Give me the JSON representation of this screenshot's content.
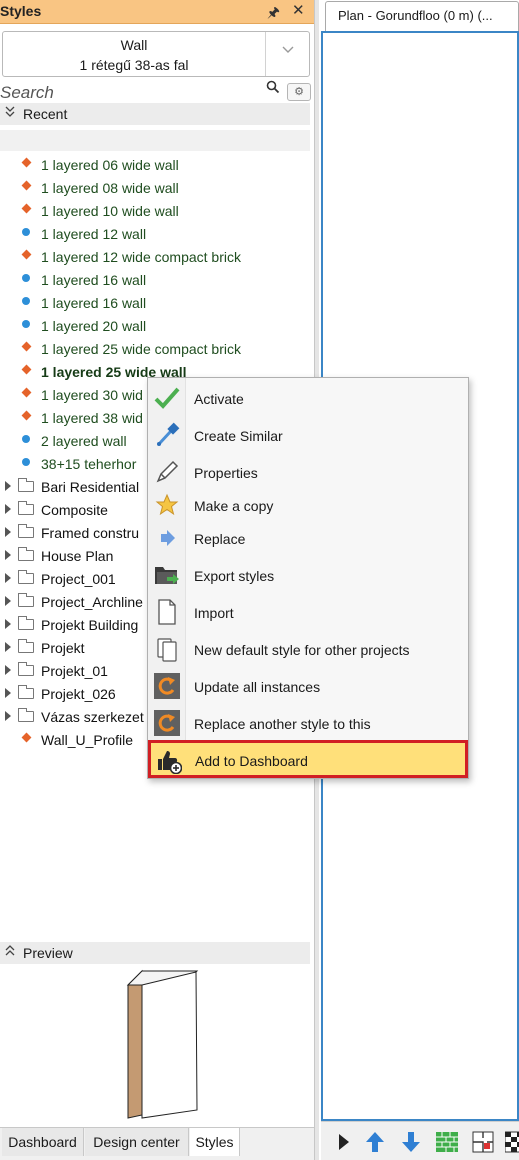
{
  "panel": {
    "title": "Styles",
    "pin_glyph": "🖈",
    "close_glyph": "✕"
  },
  "style_selector": {
    "category": "Wall",
    "current_style": "1 rétegű 38-as fal"
  },
  "search": {
    "placeholder": "Search"
  },
  "recent_label": "Recent",
  "tree_items": [
    {
      "label": "1 layered 06 wide wall",
      "marker": "diamond"
    },
    {
      "label": "1 layered 08 wide wall",
      "marker": "diamond"
    },
    {
      "label": "1 layered 10 wide wall",
      "marker": "diamond"
    },
    {
      "label": "1 layered 12 wall",
      "marker": "dot"
    },
    {
      "label": "1 layered 12 wide compact brick",
      "marker": "diamond"
    },
    {
      "label": "1 layered 16 wall",
      "marker": "dot"
    },
    {
      "label": "1 layered 16 wall",
      "marker": "dot"
    },
    {
      "label": "1 layered 20 wall",
      "marker": "dot"
    },
    {
      "label": "1 layered 25 wide compact brick",
      "marker": "diamond"
    },
    {
      "label": "1 layered 25 wide wall",
      "marker": "diamond",
      "bold": true
    },
    {
      "label": "1 layered 30 wid",
      "marker": "diamond"
    },
    {
      "label": "1 layered 38 wid",
      "marker": "diamond"
    },
    {
      "label": "2 layered wall",
      "marker": "dot"
    },
    {
      "label": "38+15 teherhor",
      "marker": "dot"
    }
  ],
  "folders": [
    {
      "label": "Bari Residential"
    },
    {
      "label": "Composite"
    },
    {
      "label": "Framed constru"
    },
    {
      "label": "House Plan"
    },
    {
      "label": "Project_001"
    },
    {
      "label": "Project_Archline"
    },
    {
      "label": "Projekt Building"
    },
    {
      "label": "Projekt"
    },
    {
      "label": "Projekt_01"
    },
    {
      "label": "Projekt_026"
    },
    {
      "label": "Vázas szerkezet"
    }
  ],
  "last_item": {
    "label": "Wall_U_Profile",
    "marker": "diamond"
  },
  "preview_label": "Preview",
  "bottom_tabs": [
    {
      "label": "Dashboard",
      "active": false
    },
    {
      "label": "Design center",
      "active": false
    },
    {
      "label": "Styles",
      "active": true
    }
  ],
  "plan_tab": {
    "label": "Plan - Gorundfloo (0 m) (..."
  },
  "context_menu": {
    "items": [
      {
        "label": "Activate",
        "icon": "check-icon"
      },
      {
        "label": "Create Similar",
        "icon": "eyedropper-icon"
      },
      {
        "label": "Properties",
        "icon": "pencil-icon"
      },
      {
        "label": "Make a copy",
        "icon": "star-icon"
      },
      {
        "label": "Replace",
        "icon": "arrow-right-icon"
      },
      {
        "label": "Export styles",
        "icon": "folder-export-icon"
      },
      {
        "label": "Import",
        "icon": "document-icon"
      },
      {
        "label": "New default style for other projects",
        "icon": "copy-pages-icon"
      },
      {
        "label": "Update all instances",
        "icon": "update-icon"
      },
      {
        "label": "Replace another style to this",
        "icon": "replace-style-icon"
      },
      {
        "label": "Add to Dashboard",
        "icon": "thumbs-up-add-icon",
        "highlighted": true
      }
    ]
  },
  "colors": {
    "header_orange": "#f9c583",
    "diamond_marker": "#e5632a",
    "dot_marker": "#2d8fd8",
    "highlight_fill": "#ffe07a",
    "highlight_border": "#d11f24",
    "canvas_border": "#3b86c6"
  }
}
